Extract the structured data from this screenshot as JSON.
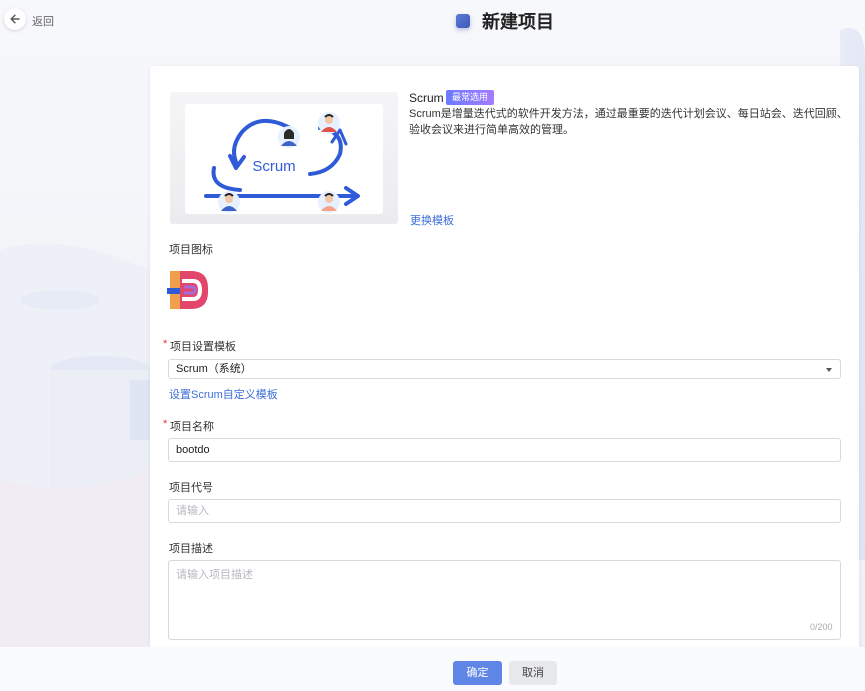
{
  "header": {
    "back_label": "返回",
    "title": "新建项目"
  },
  "template": {
    "name": "Scrum",
    "badge": "最常选用",
    "description": "Scrum是增量迭代式的软件开发方法，通过最重要的迭代计划会议、每日站会、迭代回顾、验收会议来进行简单高效的管理。",
    "change_link": "更换模板",
    "thumbnail_text": "Scrum"
  },
  "form": {
    "icon_label": "项目图标",
    "settings_template_label": "项目设置模板",
    "settings_template_value": "Scrum（系统）",
    "custom_template_link": "设置Scrum自定义模板",
    "name_label": "项目名称",
    "name_value": "bootdo",
    "code_label": "项目代号",
    "code_placeholder": "请输入",
    "desc_label": "项目描述",
    "desc_placeholder": "请输入项目描述",
    "desc_counter": "0/200"
  },
  "footer": {
    "ok_label": "确定",
    "cancel_label": "取消"
  },
  "colors": {
    "accent": "#5f86e6",
    "link": "#3d6fd8",
    "required": "#e33333"
  }
}
